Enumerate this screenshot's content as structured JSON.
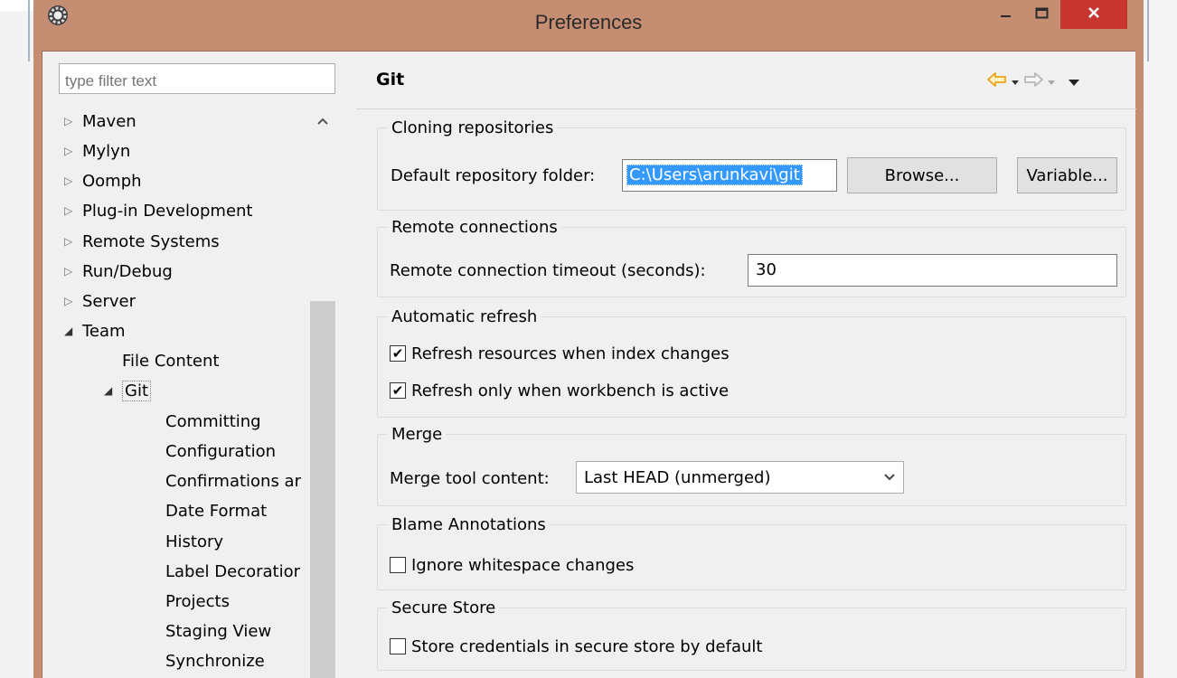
{
  "window": {
    "title": "Preferences",
    "icons": {
      "app": "eclipse-gear-icon",
      "minimize": "minimize-icon",
      "maximize": "maximize-icon",
      "close": "close-icon"
    }
  },
  "filter": {
    "placeholder": "type filter text"
  },
  "tree": {
    "items": [
      {
        "label": "Maven",
        "level": 0,
        "state": "collapsed"
      },
      {
        "label": "Mylyn",
        "level": 0,
        "state": "collapsed"
      },
      {
        "label": "Oomph",
        "level": 0,
        "state": "collapsed"
      },
      {
        "label": "Plug-in Development",
        "level": 0,
        "state": "collapsed"
      },
      {
        "label": "Remote Systems",
        "level": 0,
        "state": "collapsed"
      },
      {
        "label": "Run/Debug",
        "level": 0,
        "state": "collapsed"
      },
      {
        "label": "Server",
        "level": 0,
        "state": "collapsed"
      },
      {
        "label": "Team",
        "level": 0,
        "state": "expanded"
      },
      {
        "label": "File Content",
        "level": 1,
        "state": "leaf"
      },
      {
        "label": "Git",
        "level": 1,
        "state": "expanded",
        "selected": true
      },
      {
        "label": "Committing",
        "level": 2,
        "state": "leaf"
      },
      {
        "label": "Configuration",
        "level": 2,
        "state": "leaf"
      },
      {
        "label": "Confirmations ar",
        "level": 2,
        "state": "leaf"
      },
      {
        "label": "Date Format",
        "level": 2,
        "state": "leaf"
      },
      {
        "label": "History",
        "level": 2,
        "state": "leaf"
      },
      {
        "label": "Label Decoratior",
        "level": 2,
        "state": "leaf"
      },
      {
        "label": "Projects",
        "level": 2,
        "state": "leaf"
      },
      {
        "label": "Staging View",
        "level": 2,
        "state": "leaf"
      },
      {
        "label": "Synchronize",
        "level": 2,
        "state": "leaf"
      }
    ]
  },
  "page": {
    "title": "Git",
    "nav_icons": {
      "back": "back-arrow-icon",
      "forward": "forward-arrow-icon",
      "menu": "view-menu-icon"
    }
  },
  "groups": {
    "cloning": {
      "title": "Cloning repositories",
      "folder_label": "Default repository folder:",
      "folder_value": "C:\\Users\\arunkavi\\git",
      "browse_label": "Browse...",
      "variable_label": "Variable..."
    },
    "remote": {
      "title": "Remote connections",
      "timeout_label": "Remote connection timeout (seconds):",
      "timeout_value": "30"
    },
    "refresh": {
      "title": "Automatic refresh",
      "opt1_label": "Refresh resources when index changes",
      "opt1_checked": true,
      "opt2_label": "Refresh only when workbench is active",
      "opt2_checked": true
    },
    "merge": {
      "title": "Merge",
      "tool_label": "Merge tool content:",
      "tool_value": "Last HEAD (unmerged)"
    },
    "blame": {
      "title": "Blame Annotations",
      "opt_label": "Ignore whitespace changes",
      "opt_checked": false
    },
    "secure": {
      "title": "Secure Store",
      "opt_label": "Store credentials in secure store by default",
      "opt_checked": false
    }
  },
  "colors": {
    "titlebar": "#c58d72",
    "close": "#c7372f",
    "selection": "#3399ff",
    "back_arrow": "#e8a21a"
  }
}
